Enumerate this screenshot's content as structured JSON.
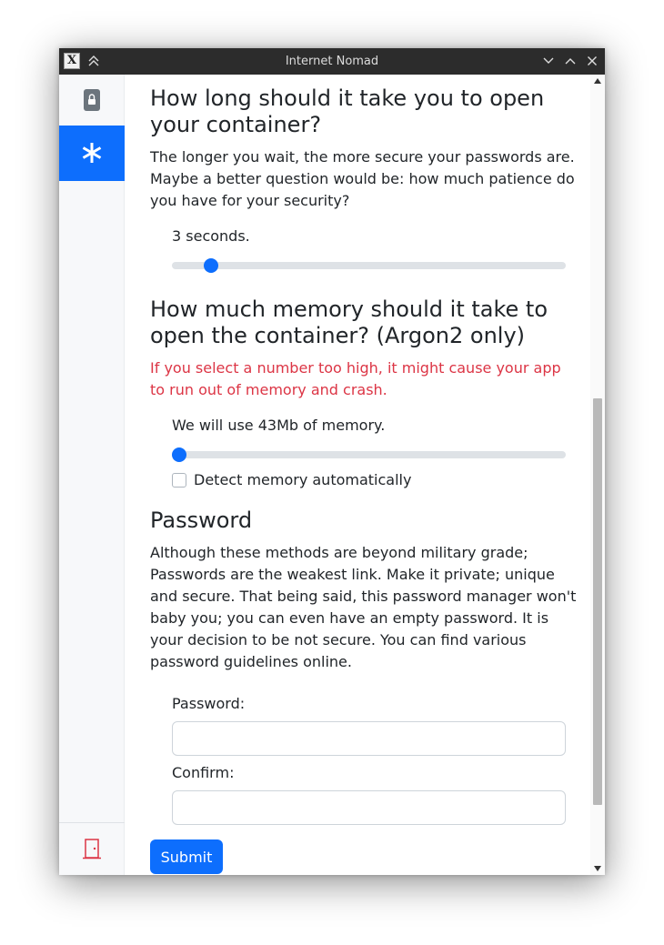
{
  "window": {
    "title": "Internet Nomad"
  },
  "sidebar": {
    "items": [
      {
        "icon": "lock-icon",
        "active": false
      },
      {
        "icon": "asterisk-icon",
        "active": true
      },
      {
        "icon": "door-exit-icon",
        "active": false
      }
    ]
  },
  "time_section": {
    "heading": "How long should it take you to open your container?",
    "description": "The longer you wait, the more secure your passwords are. Maybe a better question would be: how much patience do you have for your security?",
    "slider_label": "3 seconds.",
    "slider_fraction": 0.085
  },
  "memory_section": {
    "heading": "How much memory should it take to open the container? (Argon2 only)",
    "warning": "If you select a number too high, it might cause your app to run out of memory and crash.",
    "slider_label": "We will use 43Mb of memory.",
    "slider_fraction": 0.0,
    "auto_detect_label": "Detect memory automatically",
    "auto_detect_checked": false
  },
  "password_section": {
    "heading": "Password",
    "description": "Although these methods are beyond military grade; Passwords are the weakest link. Make it private; unique and secure. That being said, this password manager won't baby you; you can even have an empty password. It is your decision to be not secure. You can find various password guidelines online.",
    "password_label": "Password:",
    "password_value": "",
    "confirm_label": "Confirm:",
    "confirm_value": "",
    "submit_label": "Submit"
  },
  "colors": {
    "accent": "#0d6efd",
    "danger": "#dc3545",
    "exit_icon": "#dc3545"
  }
}
